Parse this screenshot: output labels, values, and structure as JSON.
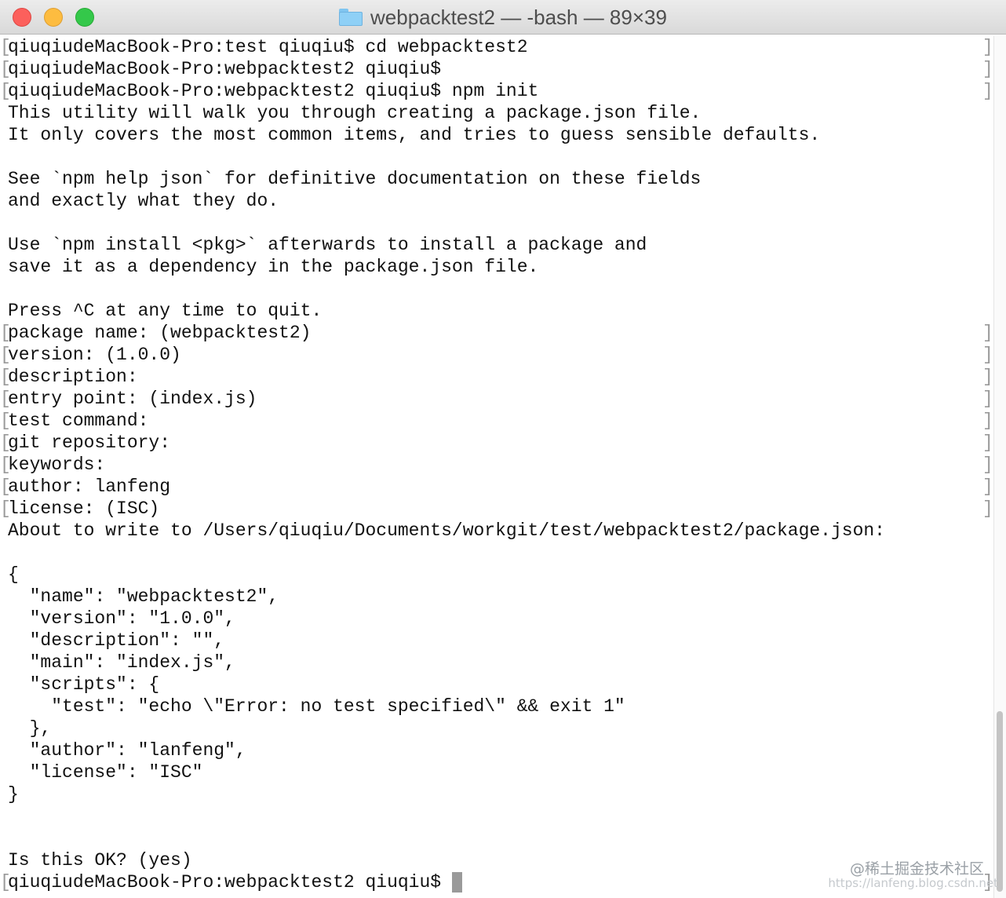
{
  "window": {
    "title": "webpacktest2 — -bash — 89×39"
  },
  "terminal": {
    "lines": [
      {
        "text": "qiuqiudeMacBook-Pro:test qiuqiu$ cd webpacktest2",
        "marked": true
      },
      {
        "text": "qiuqiudeMacBook-Pro:webpacktest2 qiuqiu$",
        "marked": true
      },
      {
        "text": "qiuqiudeMacBook-Pro:webpacktest2 qiuqiu$ npm init",
        "marked": true
      },
      {
        "text": "This utility will walk you through creating a package.json file.",
        "marked": false
      },
      {
        "text": "It only covers the most common items, and tries to guess sensible defaults.",
        "marked": false
      },
      {
        "text": "",
        "marked": false
      },
      {
        "text": "See `npm help json` for definitive documentation on these fields",
        "marked": false
      },
      {
        "text": "and exactly what they do.",
        "marked": false
      },
      {
        "text": "",
        "marked": false
      },
      {
        "text": "Use `npm install <pkg>` afterwards to install a package and",
        "marked": false
      },
      {
        "text": "save it as a dependency in the package.json file.",
        "marked": false
      },
      {
        "text": "",
        "marked": false
      },
      {
        "text": "Press ^C at any time to quit.",
        "marked": false
      },
      {
        "text": "package name: (webpacktest2)",
        "marked": true
      },
      {
        "text": "version: (1.0.0)",
        "marked": true
      },
      {
        "text": "description:",
        "marked": true
      },
      {
        "text": "entry point: (index.js)",
        "marked": true
      },
      {
        "text": "test command:",
        "marked": true
      },
      {
        "text": "git repository:",
        "marked": true
      },
      {
        "text": "keywords:",
        "marked": true
      },
      {
        "text": "author: lanfeng",
        "marked": true
      },
      {
        "text": "license: (ISC)",
        "marked": true
      },
      {
        "text": "About to write to /Users/qiuqiu/Documents/workgit/test/webpacktest2/package.json:",
        "marked": false
      },
      {
        "text": "",
        "marked": false
      },
      {
        "text": "{",
        "marked": false
      },
      {
        "text": "  \"name\": \"webpacktest2\",",
        "marked": false
      },
      {
        "text": "  \"version\": \"1.0.0\",",
        "marked": false
      },
      {
        "text": "  \"description\": \"\",",
        "marked": false
      },
      {
        "text": "  \"main\": \"index.js\",",
        "marked": false
      },
      {
        "text": "  \"scripts\": {",
        "marked": false
      },
      {
        "text": "    \"test\": \"echo \\\"Error: no test specified\\\" && exit 1\"",
        "marked": false
      },
      {
        "text": "  },",
        "marked": false
      },
      {
        "text": "  \"author\": \"lanfeng\",",
        "marked": false
      },
      {
        "text": "  \"license\": \"ISC\"",
        "marked": false
      },
      {
        "text": "}",
        "marked": false
      },
      {
        "text": "",
        "marked": false
      },
      {
        "text": "",
        "marked": false
      },
      {
        "text": "Is this OK? (yes)",
        "marked": false
      }
    ],
    "prompt": "qiuqiudeMacBook-Pro:webpacktest2 qiuqiu$ "
  },
  "watermark": {
    "text": "@稀土掘金技术社区",
    "url": "https://lanfeng.blog.csdn.net"
  }
}
